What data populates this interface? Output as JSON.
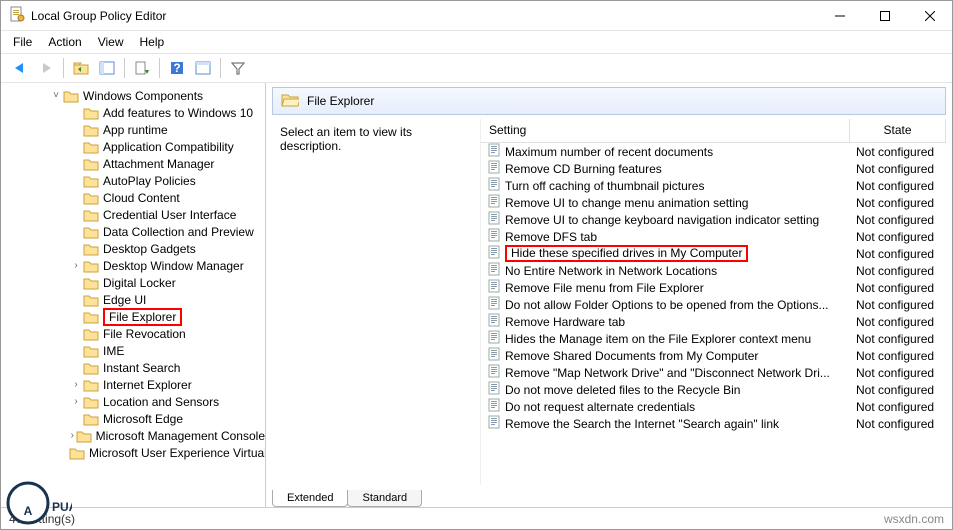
{
  "titlebar": {
    "title": "Local Group Policy Editor"
  },
  "menubar": {
    "file": "File",
    "action": "Action",
    "view": "View",
    "help": "Help"
  },
  "toolbar": {
    "back": "back",
    "forward": "forward",
    "up": "up-folder",
    "show": "show-hide",
    "export": "export",
    "help": "help",
    "props": "properties",
    "filter": "filter"
  },
  "tree": {
    "root": "Windows Components",
    "items": [
      "Add features to Windows 10",
      "App runtime",
      "Application Compatibility",
      "Attachment Manager",
      "AutoPlay Policies",
      "Cloud Content",
      "Credential User Interface",
      "Data Collection and Preview",
      "Desktop Gadgets",
      "Desktop Window Manager",
      "Digital Locker",
      "Edge UI",
      "File Explorer",
      "File Revocation",
      "IME",
      "Instant Search",
      "Internet Explorer",
      "Location and Sensors",
      "Microsoft Edge",
      "Microsoft Management Console",
      "Microsoft User Experience Virtualization"
    ],
    "expandable": [
      9,
      16,
      17,
      19
    ],
    "highlighted": 12
  },
  "right": {
    "header_label": "File Explorer",
    "desc_hint": "Select an item to view its description.",
    "columns": {
      "setting": "Setting",
      "state": "State"
    },
    "settings": [
      {
        "name": "Maximum number of recent documents",
        "state": "Not configured"
      },
      {
        "name": "Remove CD Burning features",
        "state": "Not configured"
      },
      {
        "name": "Turn off caching of thumbnail pictures",
        "state": "Not configured"
      },
      {
        "name": "Remove UI to change menu animation setting",
        "state": "Not configured"
      },
      {
        "name": "Remove UI to change keyboard navigation indicator setting",
        "state": "Not configured"
      },
      {
        "name": "Remove DFS tab",
        "state": "Not configured"
      },
      {
        "name": "Hide these specified drives in My Computer",
        "state": "Not configured"
      },
      {
        "name": "No Entire Network in Network Locations",
        "state": "Not configured"
      },
      {
        "name": "Remove File menu from File Explorer",
        "state": "Not configured"
      },
      {
        "name": "Do not allow Folder Options to be opened from the Options...",
        "state": "Not configured"
      },
      {
        "name": "Remove Hardware tab",
        "state": "Not configured"
      },
      {
        "name": "Hides the Manage item on the File Explorer context menu",
        "state": "Not configured"
      },
      {
        "name": "Remove Shared Documents from My Computer",
        "state": "Not configured"
      },
      {
        "name": "Remove \"Map Network Drive\" and \"Disconnect Network Dri...",
        "state": "Not configured"
      },
      {
        "name": "Do not move deleted files to the Recycle Bin",
        "state": "Not configured"
      },
      {
        "name": "Do not request alternate credentials",
        "state": "Not configured"
      },
      {
        "name": "Remove the Search the Internet \"Search again\" link",
        "state": "Not configured"
      }
    ],
    "highlighted": 6,
    "tabs": {
      "extended": "Extended",
      "standard": "Standard"
    }
  },
  "statusbar": {
    "count": "47 setting(s)",
    "watermark": "wsxdn.com"
  },
  "logo_text": "PUALS"
}
